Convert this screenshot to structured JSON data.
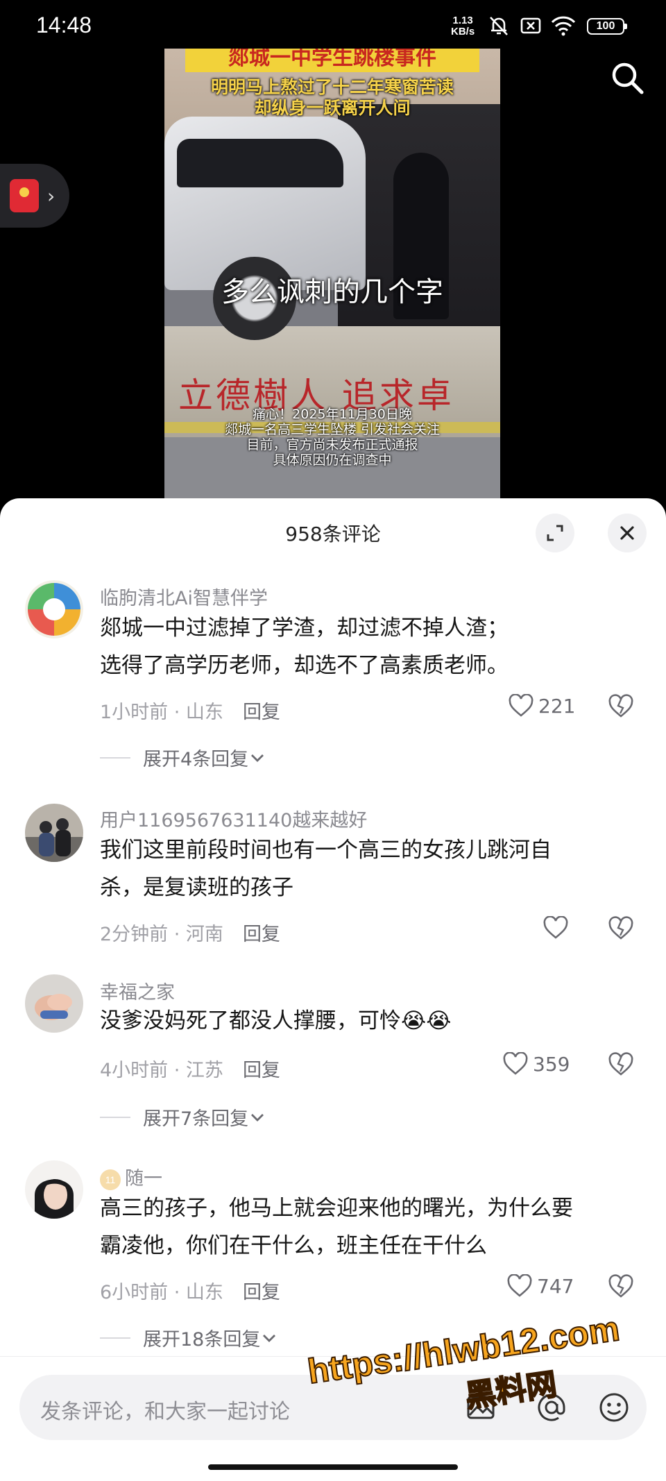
{
  "status_bar": {
    "time": "14:48",
    "net_speed": "1.13",
    "net_unit": "KB/s",
    "battery": "100"
  },
  "video": {
    "title_banner": "郯城一中学生跳楼事件",
    "subtitle_line1": "明明马上熬过了十二年寒窗苦读",
    "subtitle_line2": "却纵身一跃离开人间",
    "wall_slogan": "立德樹人  追求卓",
    "center_caption": "多么讽刺的几个字",
    "bottom_caption_1": "痛心！2025年11月30日晚",
    "bottom_caption_2": "郯城一名高三学生坠楼 引发社会关注",
    "bottom_caption_3": "目前，官方尚未发布正式通报",
    "bottom_caption_4": "具体原因仍在调查中"
  },
  "comments_panel": {
    "title": "958条评论"
  },
  "comments": [
    {
      "user": "临朐清北Ai智慧伴学",
      "lines": [
        "郯城一中过滤掉了学渣，却过滤不掉人渣；",
        "选得了高学历老师，却选不了高素质老师。"
      ],
      "time_location": "1小时前 · 山东",
      "reply": "回复",
      "likes": "221",
      "expand": "展开4条回复"
    },
    {
      "user": "用户1169567631140越来越好",
      "lines": [
        "我们这里前段时间也有一个高三的女孩儿跳河自",
        "杀，是复读班的孩子"
      ],
      "time_location": "2分钟前 · 河南",
      "reply": "回复",
      "likes": ""
    },
    {
      "user": "幸福之家",
      "lines": [
        "没爹没妈死了都没人撑腰，可怜😭😭"
      ],
      "time_location": "4小时前 · 江苏",
      "reply": "回复",
      "likes": "359",
      "expand": "展开7条回复"
    },
    {
      "user": "随一",
      "user_badge": "11",
      "lines": [
        "高三的孩子，他马上就会迎来他的曙光，为什么要",
        "霸凌他，你们在干什么，班主任在干什么"
      ],
      "time_location": "6小时前 · 山东",
      "reply": "回复",
      "likes": "747",
      "expand": "展开18条回复"
    }
  ],
  "input_bar": {
    "placeholder": "发条评论，和大家一起讨论"
  },
  "watermark": {
    "url": "https://hlwb12.com",
    "name": "黑料网"
  },
  "colors": {
    "accent_like": "#6a6a70",
    "banner_yellow": "#f2d23a",
    "banner_red": "#c8271f",
    "watermark_orange": "#f7a51e"
  }
}
